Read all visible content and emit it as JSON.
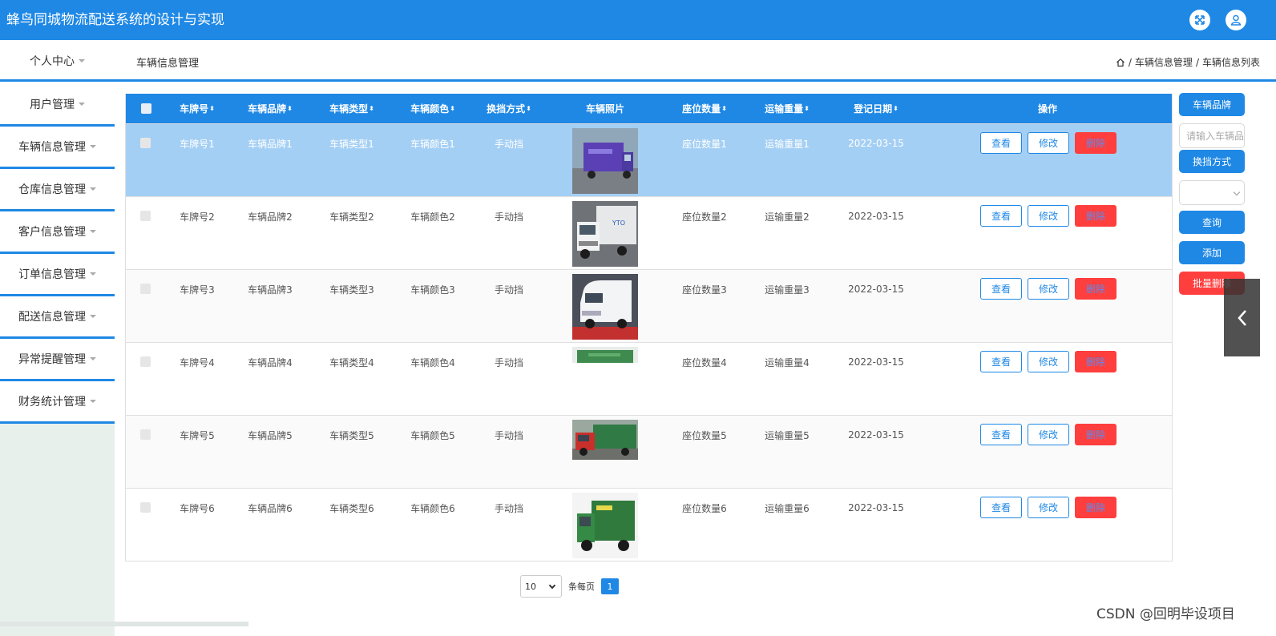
{
  "header": {
    "title": "蜂鸟同城物流配送系统的设计与实现"
  },
  "subheader": {
    "personal_center": "个人中心",
    "page_title": "车辆信息管理",
    "breadcrumb": [
      "车辆信息管理",
      "车辆信息列表"
    ]
  },
  "sidebar": {
    "items": [
      {
        "label": "用户管理"
      },
      {
        "label": "车辆信息管理"
      },
      {
        "label": "仓库信息管理"
      },
      {
        "label": "客户信息管理"
      },
      {
        "label": "订单信息管理"
      },
      {
        "label": "配送信息管理"
      },
      {
        "label": "异常提醒管理"
      },
      {
        "label": "财务统计管理"
      }
    ]
  },
  "table": {
    "columns": [
      {
        "label": "车牌号",
        "sortable": true
      },
      {
        "label": "车辆品牌",
        "sortable": true
      },
      {
        "label": "车辆类型",
        "sortable": true
      },
      {
        "label": "车辆颜色",
        "sortable": true
      },
      {
        "label": "换挡方式",
        "sortable": true
      },
      {
        "label": "车辆照片",
        "sortable": false
      },
      {
        "label": "座位数量",
        "sortable": true
      },
      {
        "label": "运输重量",
        "sortable": true
      },
      {
        "label": "登记日期",
        "sortable": true
      },
      {
        "label": "操作",
        "sortable": false
      }
    ],
    "sort_glyph": "⬍",
    "action_labels": {
      "view": "查看",
      "edit": "修改",
      "delete": "删除"
    },
    "rows": [
      {
        "plate": "车牌号1",
        "brand": "车辆品牌1",
        "type": "车辆类型1",
        "color": "车辆颜色1",
        "gear": "手动挡",
        "photo": "purple-truck",
        "seats": "座位数量1",
        "weight": "运输重量1",
        "date": "2022-03-15"
      },
      {
        "plate": "车牌号2",
        "brand": "车辆品牌2",
        "type": "车辆类型2",
        "color": "车辆颜色2",
        "gear": "手动挡",
        "photo": "white-box-truck",
        "seats": "座位数量2",
        "weight": "运输重量2",
        "date": "2022-03-15"
      },
      {
        "plate": "车牌号3",
        "brand": "车辆品牌3",
        "type": "车辆类型3",
        "color": "车辆颜色3",
        "gear": "手动挡",
        "photo": "white-van",
        "seats": "座位数量3",
        "weight": "运输重量3",
        "date": "2022-03-15"
      },
      {
        "plate": "车牌号4",
        "brand": "车辆品牌4",
        "type": "车辆类型4",
        "color": "车辆颜色4",
        "gear": "手动挡",
        "photo": "green-truck-partial",
        "seats": "座位数量4",
        "weight": "运输重量4",
        "date": "2022-03-15"
      },
      {
        "plate": "车牌号5",
        "brand": "车辆品牌5",
        "type": "车辆类型5",
        "color": "车辆颜色5",
        "gear": "手动挡",
        "photo": "red-green-truck",
        "seats": "座位数量5",
        "weight": "运输重量5",
        "date": "2022-03-15"
      },
      {
        "plate": "车牌号6",
        "brand": "车辆品牌6",
        "type": "车辆类型6",
        "color": "车辆颜色6",
        "gear": "手动挡",
        "photo": "green-cargo-truck",
        "seats": "座位数量6",
        "weight": "运输重量6",
        "date": "2022-03-15"
      }
    ]
  },
  "right_panel": {
    "brand_label": "车辆品牌",
    "brand_placeholder": "请输入车辆品牌",
    "gear_label": "换挡方式",
    "gear_selected": "",
    "search_button": "查询",
    "add_button": "添加",
    "batch_delete_button": "批量删除"
  },
  "pagination": {
    "page_size": "10",
    "per_page_label": "条每页",
    "current_page": "1"
  },
  "watermark": "CSDN @回明毕设项目",
  "colors": {
    "primary": "#1f88e5",
    "danger": "#ff3e3e",
    "selected_row": "#a4cff4"
  }
}
